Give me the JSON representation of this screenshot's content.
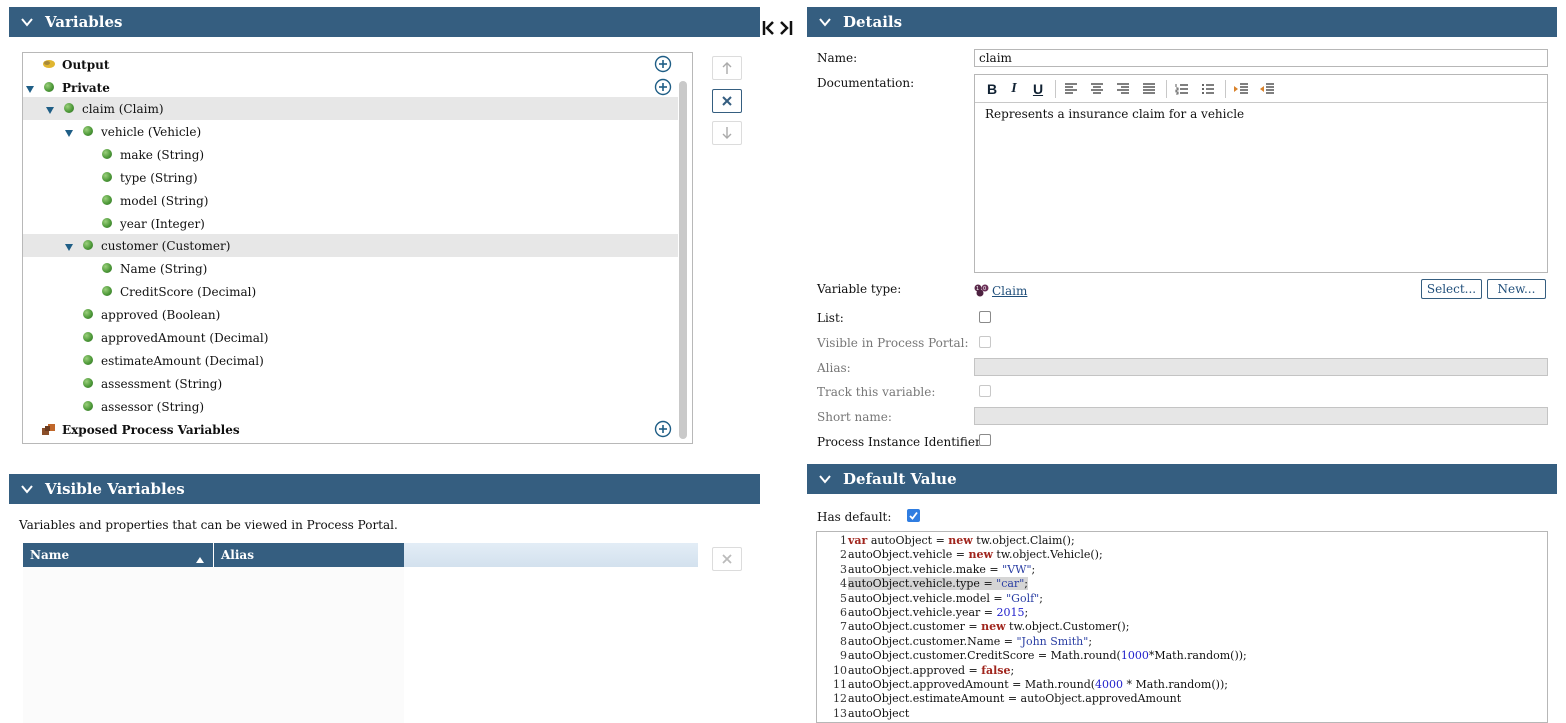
{
  "variables_panel": {
    "title": "Variables",
    "tree": [
      {
        "label": "Output",
        "bold": true,
        "icon": "output-icon",
        "plus": true
      },
      {
        "label": "Private",
        "bold": true,
        "icon": "green-ball-icon",
        "plus": true,
        "expanded": true
      },
      {
        "label": "claim (Claim)",
        "icon": "green-ball-icon",
        "expanded": true,
        "selected": true
      },
      {
        "label": "vehicle (Vehicle)",
        "icon": "green-ball-icon",
        "expanded": true
      },
      {
        "label": "make (String)",
        "icon": "green-ball-icon"
      },
      {
        "label": "type (String)",
        "icon": "green-ball-icon"
      },
      {
        "label": "model (String)",
        "icon": "green-ball-icon"
      },
      {
        "label": "year (Integer)",
        "icon": "green-ball-icon"
      },
      {
        "label": "customer (Customer)",
        "icon": "green-ball-icon",
        "expanded": true,
        "selected": true
      },
      {
        "label": "Name (String)",
        "icon": "green-ball-icon"
      },
      {
        "label": "CreditScore (Decimal)",
        "icon": "green-ball-icon"
      },
      {
        "label": "approved (Boolean)",
        "icon": "green-ball-icon"
      },
      {
        "label": "approvedAmount (Decimal)",
        "icon": "green-ball-icon"
      },
      {
        "label": "estimateAmount (Decimal)",
        "icon": "green-ball-icon"
      },
      {
        "label": "assessment (String)",
        "icon": "green-ball-icon"
      },
      {
        "label": "assessor (String)",
        "icon": "green-ball-icon"
      },
      {
        "label": "Exposed Process Variables",
        "bold": true,
        "icon": "exposed-variables-icon",
        "plus": true
      }
    ]
  },
  "visible_variables_panel": {
    "title": "Visible Variables",
    "description": "Variables and properties that can be viewed in Process Portal.",
    "columns": [
      "Name",
      "Alias"
    ]
  },
  "details_panel": {
    "title": "Details",
    "name_label": "Name:",
    "name_value": "claim",
    "documentation_label": "Documentation:",
    "documentation_text": "Represents a insurance claim for a vehicle",
    "variable_type_label": "Variable type:",
    "variable_type_value": "Claim",
    "select_button": "Select...",
    "new_button": "New...",
    "list_label": "List:",
    "visible_portal_label": "Visible in Process Portal:",
    "alias_label": "Alias:",
    "track_label": "Track this variable:",
    "short_name_label": "Short name:",
    "identifier_label": "Process Instance Identifier:"
  },
  "default_value_panel": {
    "title": "Default Value",
    "has_default_label": "Has default:",
    "has_default_checked": true,
    "code_lines": [
      {
        "n": "1",
        "parts": [
          [
            "kw",
            "var"
          ],
          [
            "t",
            " autoObject = "
          ],
          [
            "kw",
            "new"
          ],
          [
            "t",
            " tw.object.Claim();"
          ]
        ]
      },
      {
        "n": "2",
        "parts": [
          [
            "t",
            "autoObject.vehicle = "
          ],
          [
            "kw",
            "new"
          ],
          [
            "t",
            " tw.object.Vehicle();"
          ]
        ]
      },
      {
        "n": "3",
        "parts": [
          [
            "t",
            "autoObject.vehicle.make = "
          ],
          [
            "str",
            "\"VW\""
          ],
          [
            "t",
            ";"
          ]
        ]
      },
      {
        "n": "4",
        "parts": [
          [
            "hl",
            "autoObject.vehicle.type = "
          ],
          [
            "hlstr",
            "\"car\""
          ],
          [
            "hl",
            ";"
          ]
        ]
      },
      {
        "n": "5",
        "parts": [
          [
            "t",
            "autoObject.vehicle.model = "
          ],
          [
            "str",
            "\"Golf\""
          ],
          [
            "t",
            ";"
          ]
        ]
      },
      {
        "n": "6",
        "parts": [
          [
            "t",
            "autoObject.vehicle.year = "
          ],
          [
            "num",
            "2015"
          ],
          [
            "t",
            ";"
          ]
        ]
      },
      {
        "n": "7",
        "parts": [
          [
            "t",
            "autoObject.customer = "
          ],
          [
            "kw",
            "new"
          ],
          [
            "t",
            " tw.object.Customer();"
          ]
        ]
      },
      {
        "n": "8",
        "parts": [
          [
            "t",
            "autoObject.customer.Name = "
          ],
          [
            "str",
            "\"John Smith\""
          ],
          [
            "t",
            ";"
          ]
        ]
      },
      {
        "n": "9",
        "parts": [
          [
            "t",
            "autoObject.customer.CreditScore = Math.round("
          ],
          [
            "num",
            "1000"
          ],
          [
            "t",
            "*Math.random());"
          ]
        ]
      },
      {
        "n": "10",
        "parts": [
          [
            "t",
            "autoObject.approved = "
          ],
          [
            "kw",
            "false"
          ],
          [
            "t",
            ";"
          ]
        ]
      },
      {
        "n": "11",
        "parts": [
          [
            "t",
            "autoObject.approvedAmount = Math.round("
          ],
          [
            "num",
            "4000"
          ],
          [
            "t",
            " * Math.random());"
          ]
        ]
      },
      {
        "n": "12",
        "parts": [
          [
            "t",
            "autoObject.estimateAmount = autoObject.approvedAmount"
          ]
        ]
      },
      {
        "n": "13",
        "parts": [
          [
            "t",
            "autoObject"
          ]
        ]
      }
    ]
  },
  "colors": {
    "header_bg": "#355e80",
    "header_text": "#ffffff",
    "keyword": "#a0251d",
    "string": "#2a3ea3",
    "number": "#2222cc"
  }
}
